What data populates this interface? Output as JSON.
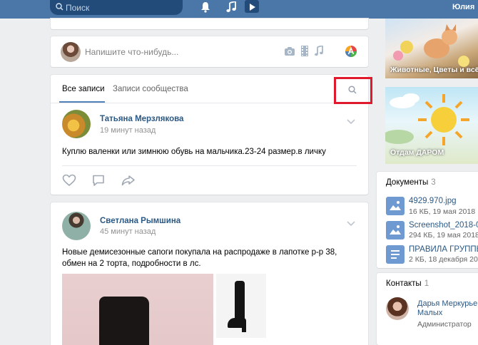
{
  "header": {
    "search_placeholder": "Поиск",
    "user_name": "Юлия",
    "icons": [
      "search-icon",
      "bell-icon",
      "music-note-icon",
      "play-icon"
    ]
  },
  "composer": {
    "placeholder": "Напишите что-нибудь...",
    "icons": [
      "camera-icon",
      "video-icon",
      "music-icon",
      "rainbow-icon"
    ]
  },
  "feed": {
    "tabs": [
      {
        "label": "Все записи",
        "active": true
      },
      {
        "label": "Записи сообщества",
        "active": false
      }
    ],
    "search_icon": "search-icon"
  },
  "posts": [
    {
      "author": "Татьяна Мерзлякова",
      "time": "19 минут назад",
      "text": "Куплю валенки или зимнюю обувь на мальчика.23-24 размер.в личку",
      "actions": [
        "like-icon",
        "comment-icon",
        "share-icon"
      ]
    },
    {
      "author": "Светлана Рымшина",
      "time": "45 минут назад",
      "text": "Новые демисезонные сапоги покупала на распродаже в лапотке р-р 38, обмен на 2 торта, подробности в лс."
    }
  ],
  "sidebar": {
    "albums": [
      {
        "caption": "Животные, Цветы и всё..."
      },
      {
        "caption": "Отдам ДАРОМ"
      }
    ],
    "documents": {
      "title": "Документы",
      "count": "3",
      "items": [
        {
          "name": "4929.970.jpg",
          "meta": "16 КБ, 19 мая 2018"
        },
        {
          "name": "Screenshot_2018-0...",
          "meta": "294 КБ, 19 мая 2018"
        },
        {
          "name": "ПРАВИЛА ГРУППЫ",
          "meta": "2 КБ, 18 декабря 2017"
        }
      ]
    },
    "contacts": {
      "title": "Контакты",
      "count": "1",
      "items": [
        {
          "name_line1": "Дарья Меркурьева",
          "name_line2": "Малых",
          "role": "Администратор"
        }
      ]
    }
  },
  "colors": {
    "header": "#4a76a8",
    "link": "#2a5885",
    "accent": "#5181b8",
    "highlight": "#e1192c",
    "background": "#edeef0"
  }
}
